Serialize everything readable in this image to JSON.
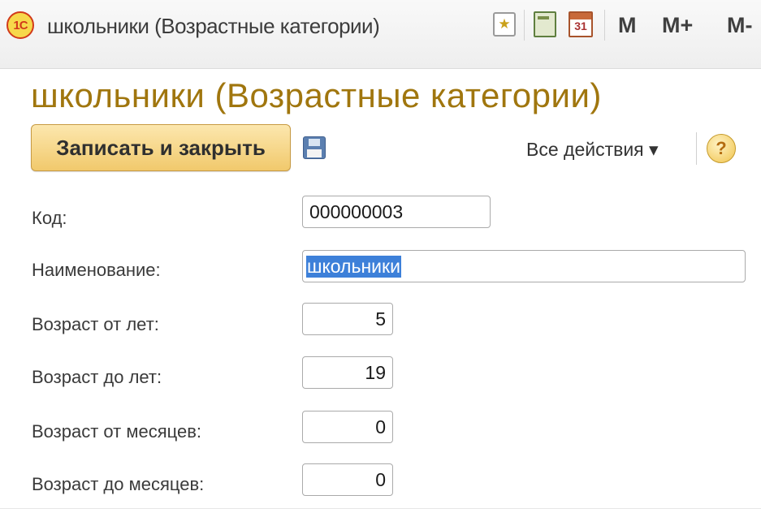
{
  "window": {
    "app_logo": "1С",
    "title": "школьники (Возрастные категории)",
    "toolbar": {
      "favorites_icon": "star-icon",
      "calculator_icon": "calculator-icon",
      "calendar_icon": "calendar-icon",
      "calendar_day": "31",
      "memory_buttons": [
        "M",
        "M+",
        "M-"
      ]
    }
  },
  "page": {
    "title": "школьники (Возрастные категории)"
  },
  "command_bar": {
    "save_close_label": "Записать и закрыть",
    "save_icon": "floppy-disk-icon",
    "all_actions_label": "Все действия ▾",
    "help_label": "?"
  },
  "form": {
    "fields": [
      {
        "label": "Код:",
        "value": "000000003"
      },
      {
        "label": "Наименование:",
        "value": "школьники"
      },
      {
        "label": "Возраст от лет:",
        "value": "5"
      },
      {
        "label": "Возраст до лет:",
        "value": "19"
      },
      {
        "label": "Возраст от месяцев:",
        "value": "0"
      },
      {
        "label": "Возраст до месяцев:",
        "value": "0"
      }
    ]
  },
  "colors": {
    "accent_title": "#a0760e",
    "primary_button": "#f1c96c",
    "selection": "#3d80d9"
  }
}
